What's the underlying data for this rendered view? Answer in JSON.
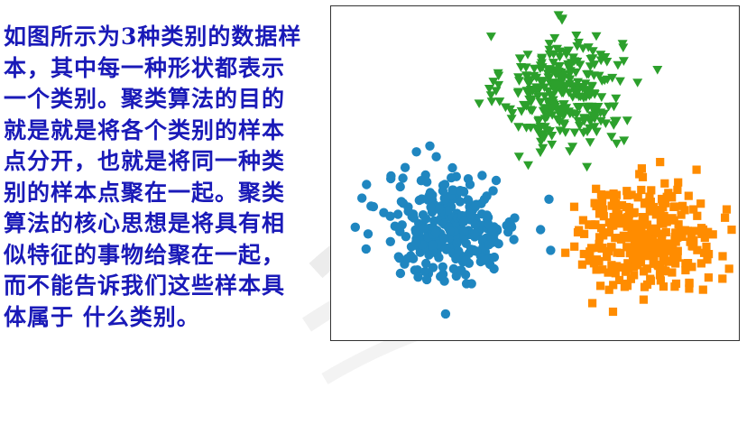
{
  "description": "如图所示为3种类别的数据样本，其中每一种形状都表示一个类别。聚类算法的目的就是就是将各个类别的样本点分开，也就是将同一种类别的样本点聚在一起。聚类算法的核心思想是将具有相似特征的事物给聚在一起，而不能告诉我们这些样本具体属于 什么类别。",
  "colors": {
    "text": "#1a1ab8",
    "blue_cluster": "#1f86c0",
    "orange_cluster": "#ff8c00",
    "green_cluster": "#2ca02c"
  },
  "chart_data": {
    "type": "scatter",
    "title": "",
    "xlabel": "",
    "ylabel": "",
    "grid": false,
    "axes_ticks": false,
    "xlim": [
      -10,
      10
    ],
    "ylim": [
      -9,
      9
    ],
    "series": [
      {
        "marker": "triangle-down",
        "color": "#2ca02c",
        "center": [
          1.4,
          4.6
        ],
        "spread": [
          1.5,
          1.6
        ],
        "count": 300
      },
      {
        "marker": "circle",
        "color": "#1f86c0",
        "center": [
          -4.2,
          -3.0
        ],
        "spread": [
          1.7,
          1.5
        ],
        "count": 300
      },
      {
        "marker": "square",
        "color": "#ff8c00",
        "center": [
          5.7,
          -3.6
        ],
        "spread": [
          1.8,
          1.5
        ],
        "count": 300
      }
    ]
  }
}
